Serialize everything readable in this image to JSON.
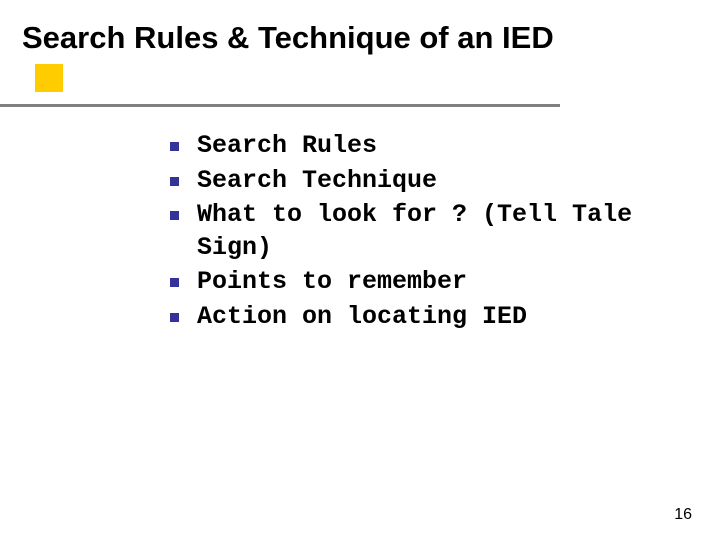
{
  "title": "Search Rules & Technique of an IED",
  "bullets": {
    "b0": "Search Rules",
    "b1": "Search Technique",
    "b2": "What to look for ? (Tell Tale Sign)",
    "b3": "Points to remember",
    "b4": "Action on locating IED"
  },
  "page_number": "16"
}
